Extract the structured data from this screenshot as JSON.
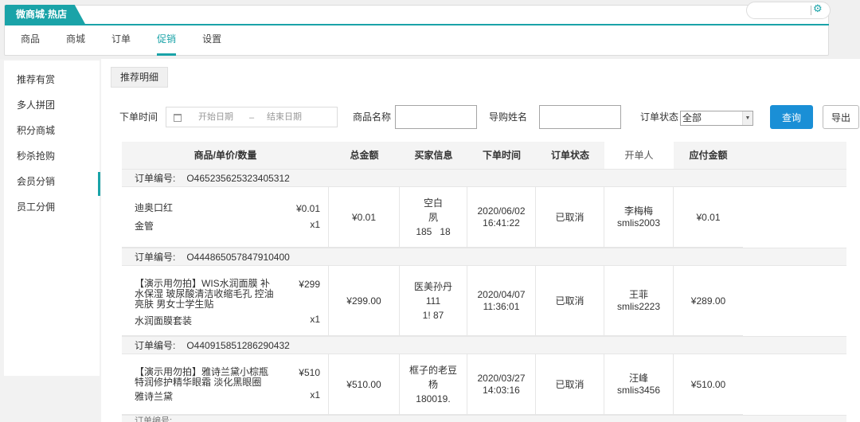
{
  "store": {
    "name": "微商城·热店"
  },
  "nav": {
    "items": [
      {
        "label": "商品"
      },
      {
        "label": "商城"
      },
      {
        "label": "订单"
      },
      {
        "label": "促销"
      },
      {
        "label": "设置"
      }
    ],
    "active_index": 3
  },
  "sidebar": {
    "items": [
      {
        "label": "推荐有赏"
      },
      {
        "label": "多人拼团"
      },
      {
        "label": "积分商城"
      },
      {
        "label": "秒杀抢购"
      },
      {
        "label": "会员分销"
      },
      {
        "label": "员工分佣"
      }
    ],
    "active_index": 4
  },
  "page": {
    "tab_label": "推荐明细"
  },
  "filters": {
    "order_time_label": "下单时间",
    "start_placeholder": "开始日期",
    "dash": "–",
    "end_placeholder": "结束日期",
    "product_name_label": "商品名称",
    "guide_name_label": "导购姓名",
    "order_status_label": "订单状态",
    "order_status_value": "全部",
    "query_button": "查询",
    "export_button": "导出"
  },
  "table": {
    "headers": [
      "商品/单价/数量",
      "总金额",
      "买家信息",
      "下单时间",
      "订单状态",
      "开单人",
      "应付金额"
    ],
    "order_no_label": "订单编号:",
    "orders": [
      {
        "order_no": "O465235625323405312",
        "product_name": "迪奥口红",
        "unit_price": "¥0.01",
        "spec": "金管",
        "qty": "x1",
        "total": "¥0.01",
        "buyer_line1": "空白",
        "buyer_line2": "夙",
        "buyer_line3": "185⁠  ⁠   ⁠ ⁠18",
        "date": "2020/06/02",
        "time": "16:41:22",
        "status": "已取消",
        "operator_name": "李梅梅",
        "operator_id": "smlis2003",
        "payable": "¥0.01"
      },
      {
        "order_no": "O444865057847910400",
        "product_name": "【演示用勿拍】WIS水润面膜 补水保湿 玻尿酸清洁收缩毛孔 控油亮肤 男女士学生贴",
        "unit_price": "¥299",
        "spec": "水润面膜套装",
        "qty": "x1",
        "total": "¥299.00",
        "buyer_line1": "医美孙丹",
        "buyer_line2": "111",
        "buyer_line3": "1!        87",
        "date": "2020/04/07",
        "time": "11:36:01",
        "status": "已取消",
        "operator_name": "王菲",
        "operator_id": "smlis2223",
        "payable": "¥289.00"
      },
      {
        "order_no": "O440915851286290432",
        "product_name": "【演示用勿拍】雅诗兰黛小棕瓶特润修护精华眼霜 淡化黑眼圈",
        "unit_price": "¥510",
        "spec": "雅诗兰黛",
        "qty": "x1",
        "total": "¥510.00",
        "buyer_line1": "框子的老豆",
        "buyer_line2": "杨",
        "buyer_line3": "180019.",
        "date": "2020/03/27",
        "time": "14:03:16",
        "status": "已取消",
        "operator_name": "汪峰",
        "operator_id": "smlis3456",
        "payable": "¥510.00"
      }
    ],
    "next_order_partial": "订单编号:"
  },
  "colors": {
    "accent": "#1aa3a8",
    "primary_button": "#1a8fd6"
  }
}
